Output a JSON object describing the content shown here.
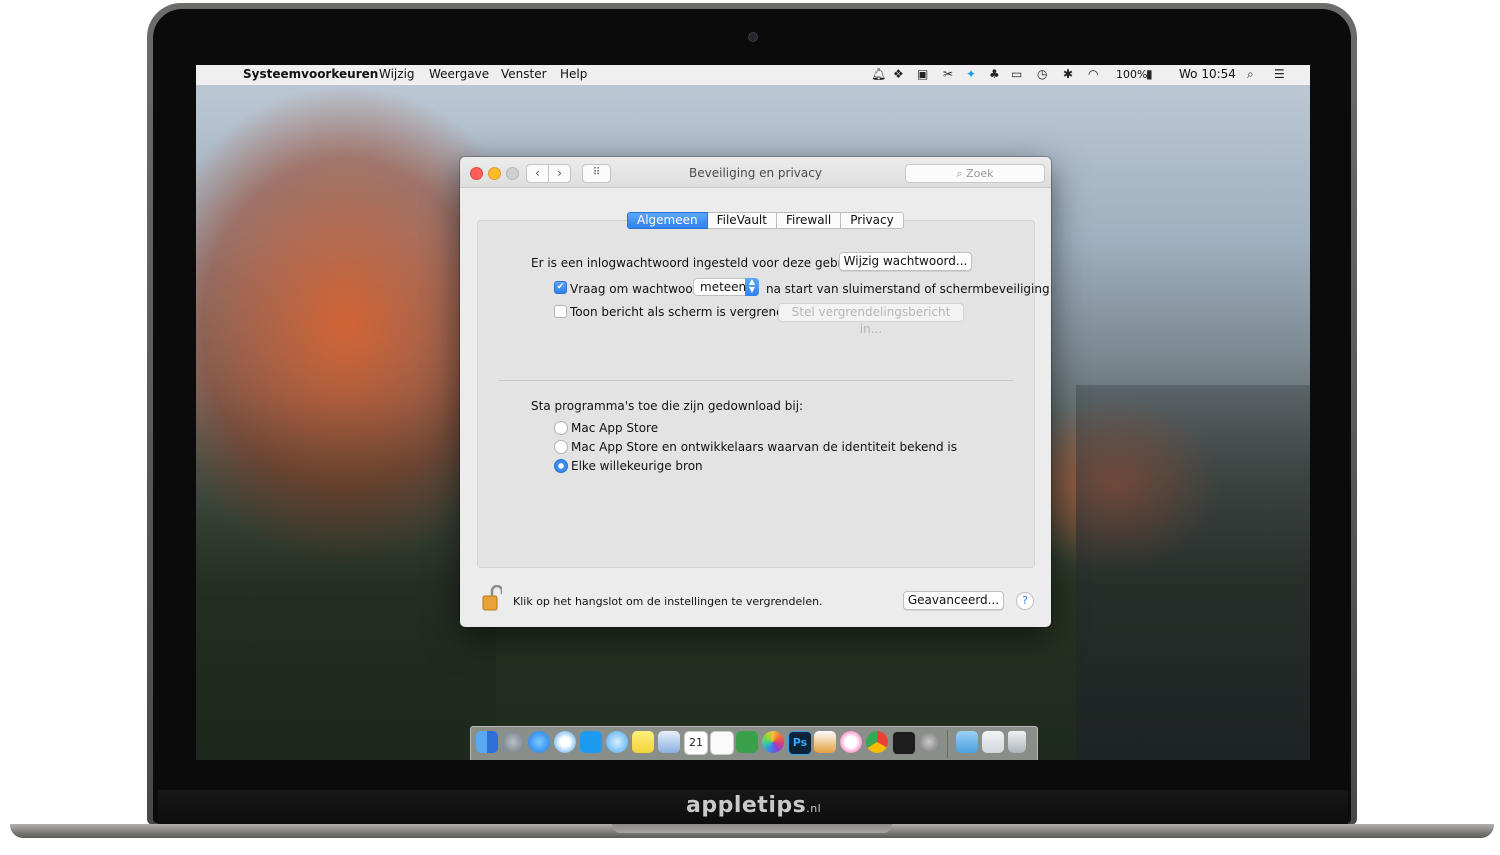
{
  "menubar": {
    "apple": "",
    "app": "Systeemvoorkeuren",
    "items": [
      "Wijzig",
      "Weergave",
      "Venster",
      "Help"
    ],
    "battery": "100%",
    "clock": "Wo 10:54"
  },
  "window": {
    "title": "Beveiliging en privacy",
    "search_placeholder": "Zoek",
    "tabs": [
      "Algemeen",
      "FileVault",
      "Firewall",
      "Privacy"
    ],
    "active_tab": "Algemeen",
    "password_text": "Er is een inlogwachtwoord ingesteld voor deze gebruiker",
    "change_password_button": "Wijzig wachtwoord...",
    "require_password_label": "Vraag om wachtwoord",
    "require_password_checked": true,
    "require_password_delay": "meteen",
    "require_password_suffix": "na start van sluimerstand of schermbeveiliging",
    "show_message_label": "Toon bericht als scherm is vergrendeld",
    "show_message_checked": false,
    "set_message_button": "Stel vergrendelingsbericht in...",
    "allow_apps_label": "Sta programma's toe die zijn gedownload bij:",
    "allow_options": [
      {
        "label": "Mac App Store",
        "selected": false
      },
      {
        "label": "Mac App Store en ontwikkelaars waarvan de identiteit bekend is",
        "selected": false
      },
      {
        "label": "Elke willekeurige bron",
        "selected": true
      }
    ],
    "lock_text": "Klik op het hangslot om de instellingen te vergrendelen.",
    "advanced_button": "Geavanceerd...",
    "help_button": "?"
  },
  "dock": {
    "apps": [
      "finder-icon",
      "launchpad-icon",
      "app-store-icon",
      "safari-icon",
      "twitter-icon",
      "messages-icon",
      "notes-icon",
      "preview-icon",
      "calendar-icon",
      "reminders-icon",
      "evernote-icon",
      "photos-icon",
      "photoshop-icon",
      "pages-icon",
      "itunes-icon",
      "chrome-icon",
      "terminal-icon",
      "system-preferences-icon",
      "downloads-folder-icon",
      "mail-icon",
      "trash-icon"
    ],
    "calendar_day": "21",
    "photoshop_label": "Ps"
  },
  "brand": {
    "name": "appletips",
    "suffix": ".nl"
  },
  "colors": {
    "accent": "#2f81ee",
    "close": "#fc5f57",
    "minimize": "#fdbc2e"
  }
}
